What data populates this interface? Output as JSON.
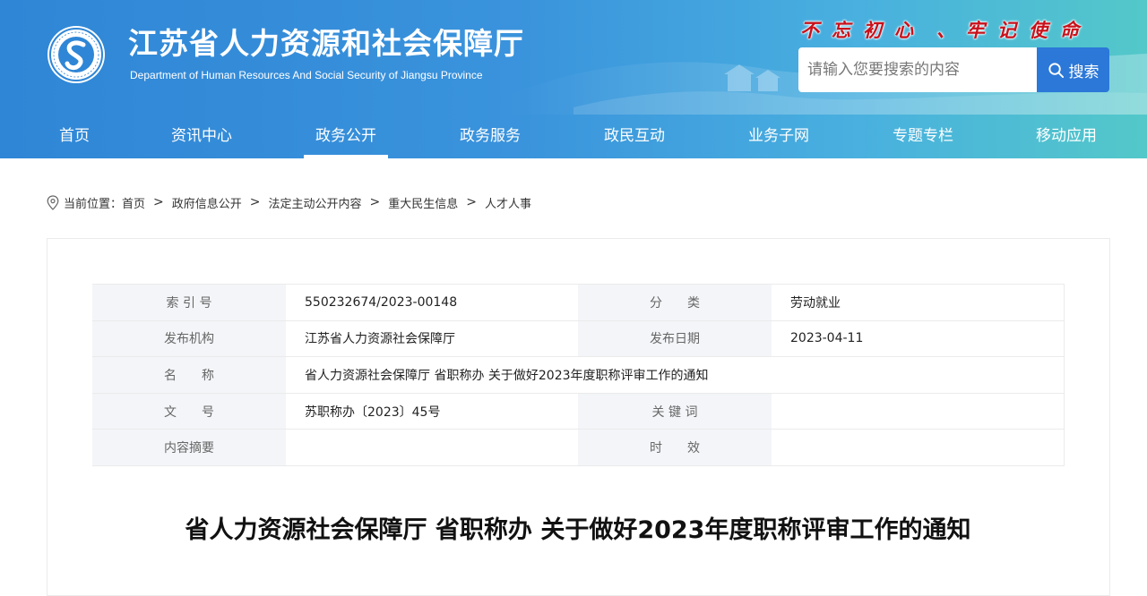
{
  "header": {
    "site_title": "江苏省人力资源和社会保障厅",
    "site_subtitle": "Department of Human Resources And Social Security of Jiangsu Province",
    "slogan": [
      "不",
      "忘",
      "初",
      "心",
      "、",
      "牢",
      "记",
      "使",
      "命"
    ],
    "search": {
      "placeholder": "请输入您要搜索的内容",
      "button_label": "搜索"
    },
    "brand_color": "#2f86d6",
    "slogan_color": "#c9101a"
  },
  "nav": {
    "items": [
      {
        "label": "首页"
      },
      {
        "label": "资讯中心"
      },
      {
        "label": "政务公开",
        "active": true
      },
      {
        "label": "政务服务"
      },
      {
        "label": "政民互动"
      },
      {
        "label": "业务子网"
      },
      {
        "label": "专题专栏"
      },
      {
        "label": "移动应用"
      }
    ]
  },
  "breadcrumb": {
    "prefix": "当前位置：",
    "items": [
      "首页",
      "政府信息公开",
      "法定主动公开内容",
      "重大民生信息",
      "人才人事"
    ],
    "separator": ">"
  },
  "meta": {
    "index_label": "索 引 号",
    "index_value": "550232674/2023-00148",
    "category_label": "分　　类",
    "category_value": "劳动就业",
    "publisher_label": "发布机构",
    "publisher_value": "江苏省人力资源社会保障厅",
    "date_label": "发布日期",
    "date_value": "2023-04-11",
    "name_label": "名　　称",
    "name_value": "省人力资源社会保障厅 省职称办 关于做好2023年度职称评审工作的通知",
    "docno_label": "文　　号",
    "docno_value": "苏职称办〔2023〕45号",
    "keywords_label": "关 键 词",
    "keywords_value": "",
    "summary_label": "内容摘要",
    "summary_value": "",
    "validity_label": "时　　效",
    "validity_value": ""
  },
  "article": {
    "title": "省人力资源社会保障厅 省职称办 关于做好2023年度职称评审工作的通知"
  }
}
